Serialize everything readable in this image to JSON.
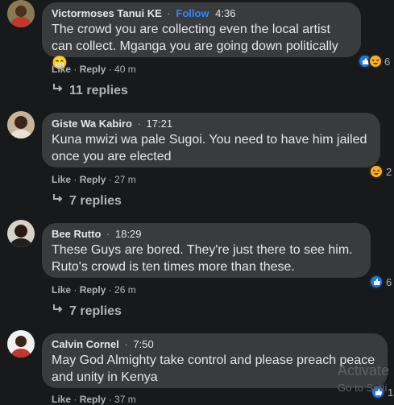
{
  "comments": [
    {
      "author": "Victormoses Tanui KE",
      "follow": "Follow",
      "time": "4:36",
      "text": "The crowd you are collecting even the local artist can collect. Mganga you are going down politically 😁",
      "like": "Like",
      "reply": "Reply",
      "age": "40 m",
      "reactions_count": "6",
      "replies": "11 replies"
    },
    {
      "author": "Giste Wa Kabiro",
      "time": "17:21",
      "text": "Kuna mwizi wa pale Sugoi. You need to have him jailed once you are elected",
      "like": "Like",
      "reply": "Reply",
      "age": "27 m",
      "reactions_count": "2",
      "replies": "7 replies"
    },
    {
      "author": "Bee Rutto",
      "time": "18:29",
      "text": "These Guys are bored. They're just there to see him. Ruto's crowd is ten times more than these.",
      "like": "Like",
      "reply": "Reply",
      "age": "26 m",
      "reactions_count": "6",
      "replies": "7 replies"
    },
    {
      "author": "Calvin Cornel",
      "time": "7:50",
      "text": "May God Almighty take control and please preach peace and unity in Kenya",
      "like": "Like",
      "reply": "Reply",
      "age": "37 m",
      "reactions_count": "1"
    }
  ],
  "watermark": {
    "line1": "Activate",
    "line2": "Go to Setti"
  },
  "colors": {
    "background": "#18191a",
    "bubble": "#3a3b3c",
    "link_blue": "#2d88ff",
    "muted": "#b0b3b8"
  }
}
